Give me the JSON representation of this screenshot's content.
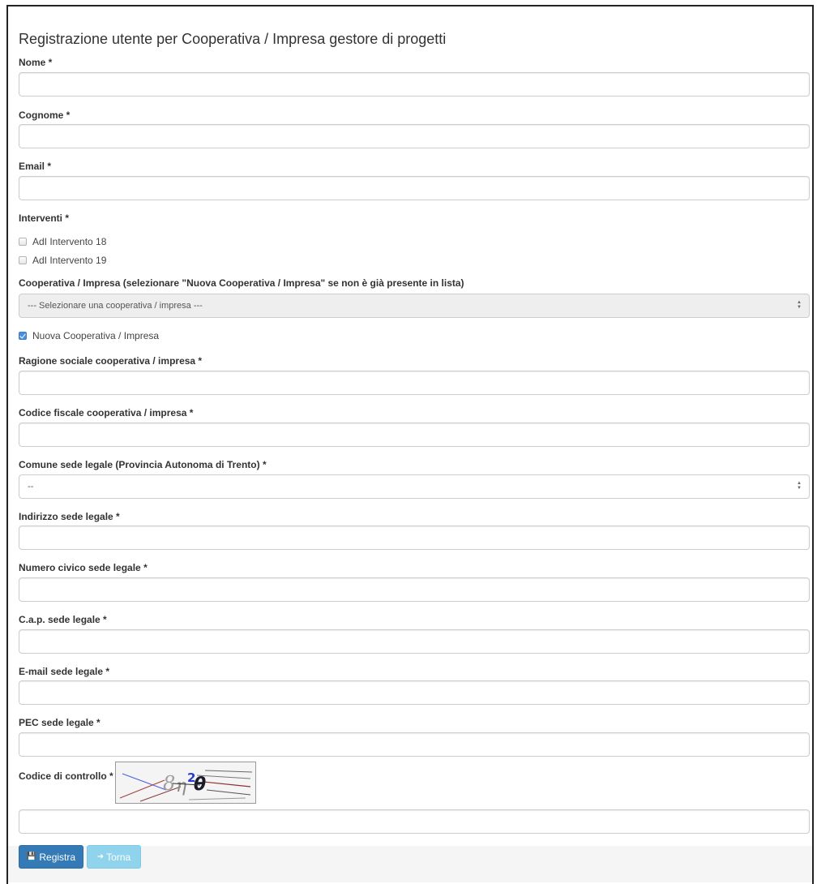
{
  "page": {
    "title": "Registrazione utente per Cooperativa / Impresa gestore di progetti"
  },
  "fields": {
    "nome_label": "Nome *",
    "cognome_label": "Cognome *",
    "email_label": "Email *",
    "interventi_label": "Interventi *",
    "cooperativa_label": "Cooperativa / Impresa (selezionare \"Nuova Cooperativa / Impresa\" se non è già presente in lista)",
    "ragione_label": "Ragione sociale cooperativa / impresa *",
    "codice_fiscale_label": "Codice fiscale cooperativa / impresa *",
    "comune_label": "Comune sede legale (Provincia Autonoma di Trento) *",
    "indirizzo_label": "Indirizzo sede legale *",
    "numero_civico_label": "Numero civico sede legale *",
    "cap_label": "C.a.p. sede legale *",
    "email_sede_label": "E-mail sede legale *",
    "pec_label": "PEC sede legale *",
    "captcha_label": "Codice di controllo *"
  },
  "interventi": [
    {
      "label": "AdI Intervento 18",
      "checked": false
    },
    {
      "label": "AdI Intervento 19",
      "checked": false
    }
  ],
  "cooperativa_select": {
    "selected": "--- Selezionare una cooperativa / impresa ---",
    "disabled": true
  },
  "nuova_cooperativa": {
    "label": "Nuova Cooperativa / Impresa",
    "checked": true
  },
  "comune_select": {
    "selected": "--"
  },
  "buttons": {
    "registra": "Registra",
    "torna": "Torna"
  },
  "colors": {
    "primary": "#337ab7",
    "info": "#8fd3ec",
    "checkbox_checked": "#4a90e2"
  },
  "icons": {
    "registra": "floppy-disk-icon",
    "torna": "log-in-icon",
    "select_arrow": "updown-arrow-icon"
  }
}
